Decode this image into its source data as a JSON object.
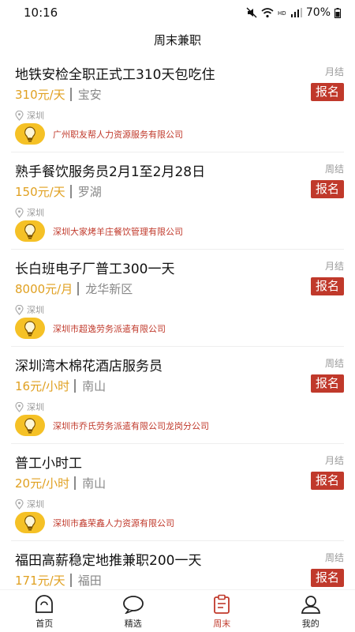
{
  "status_bar": {
    "time": "10:16",
    "battery": "70%"
  },
  "header": {
    "title": "周末兼职"
  },
  "jobs": [
    {
      "title": "地铁安检全职正式工310天包吃住",
      "settle": "月结",
      "pay": "310元/天",
      "area": "宝安",
      "city": "深圳",
      "company": "广州职友帮人力资源服务有限公司",
      "apply_label": "报名"
    },
    {
      "title": "熟手餐饮服务员2月1至2月28日",
      "settle": "周结",
      "pay": "150元/天",
      "area": "罗湖",
      "city": "深圳",
      "company": "深圳大家烤羊庄餐饮管理有限公司",
      "apply_label": "报名"
    },
    {
      "title": "长白班电子厂普工300一天",
      "settle": "月结",
      "pay": "8000元/月",
      "area": "龙华新区",
      "city": "深圳",
      "company": "深圳市超逸劳务派遣有限公司",
      "apply_label": "报名"
    },
    {
      "title": "深圳湾木棉花酒店服务员",
      "settle": "周结",
      "pay": "16元/小时",
      "area": "南山",
      "city": "深圳",
      "company": "深圳市乔氏劳务派遣有限公司龙岗分公司",
      "apply_label": "报名"
    },
    {
      "title": "普工小时工",
      "settle": "月结",
      "pay": "20元/小时",
      "area": "南山",
      "city": "深圳",
      "company": "深圳市鑫荣鑫人力资源有限公司",
      "apply_label": "报名"
    },
    {
      "title": "福田高薪稳定地推兼职200一天",
      "settle": "周结",
      "pay": "171元/天",
      "area": "福田",
      "city": "",
      "company": "",
      "apply_label": "报名"
    }
  ],
  "tabs": [
    {
      "label": "首页",
      "icon": "home-icon",
      "active": false
    },
    {
      "label": "精选",
      "icon": "chat-bubble-icon",
      "active": false
    },
    {
      "label": "周末",
      "icon": "clipboard-icon",
      "active": true
    },
    {
      "label": "我的",
      "icon": "user-icon",
      "active": false
    }
  ],
  "colors": {
    "accent": "#c0392b",
    "pay": "#e0a020",
    "badge": "#f5c126"
  }
}
